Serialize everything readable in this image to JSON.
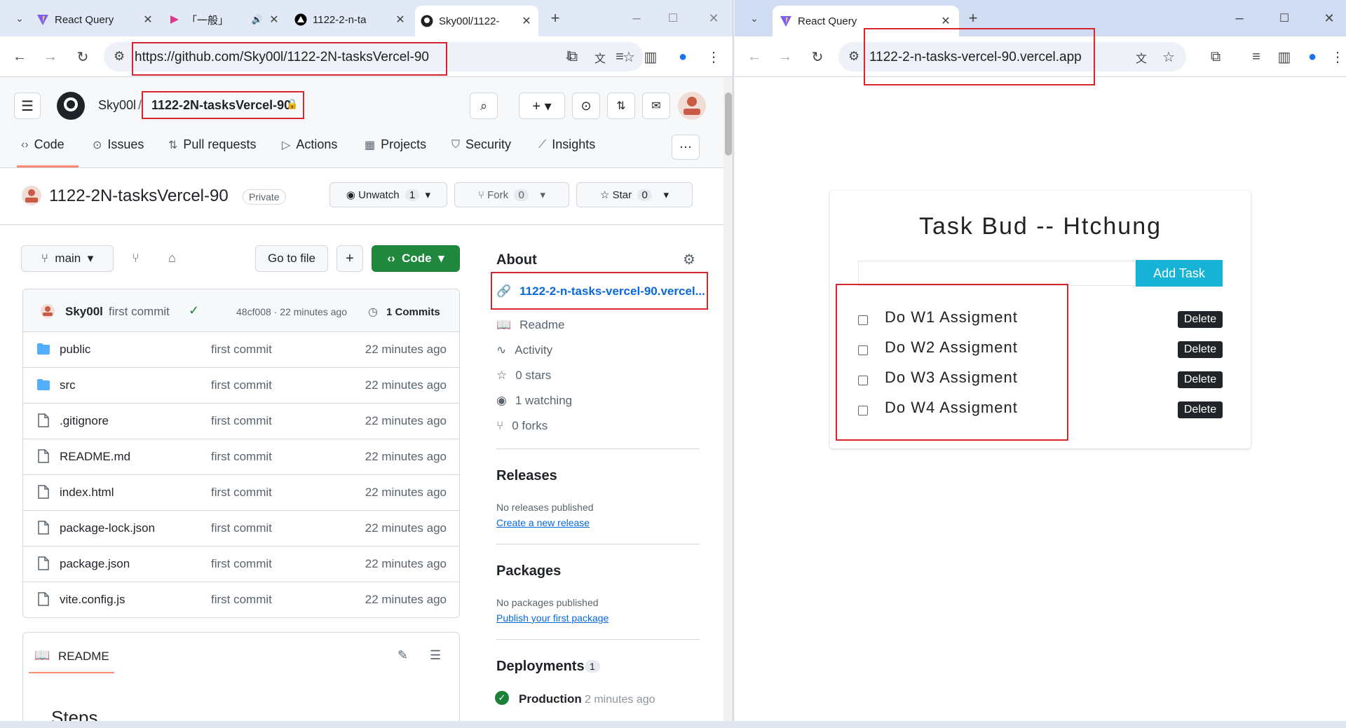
{
  "left_window": {
    "tabs": [
      {
        "title": "React Query"
      },
      {
        "title": "「一般」"
      },
      {
        "title": "1122-2-n-ta"
      },
      {
        "title": "Sky00l/1122-"
      }
    ],
    "url": "https://github.com/Sky00l/1122-2N-tasksVercel-90",
    "github": {
      "owner": "Sky00l",
      "repo": "1122-2N-tasksVercel-90",
      "nav": [
        "Code",
        "Issues",
        "Pull requests",
        "Actions",
        "Projects",
        "Security",
        "Insights"
      ],
      "visibility": "Private",
      "unwatch_label": "Unwatch",
      "unwatch_count": "1",
      "fork_label": "Fork",
      "fork_count": "0",
      "star_label": "Star",
      "star_count": "0",
      "branch": "main",
      "go_to_file": "Go to file",
      "code_btn": "Code",
      "commit": {
        "author": "Sky00l",
        "message": "first commit",
        "hash_time": "48cf008 · 22 minutes ago",
        "count": "1 Commits"
      },
      "files": [
        {
          "name": "public",
          "msg": "first commit",
          "time": "22 minutes ago",
          "type": "dir"
        },
        {
          "name": "src",
          "msg": "first commit",
          "time": "22 minutes ago",
          "type": "dir"
        },
        {
          "name": ".gitignore",
          "msg": "first commit",
          "time": "22 minutes ago",
          "type": "file"
        },
        {
          "name": "README.md",
          "msg": "first commit",
          "time": "22 minutes ago",
          "type": "file"
        },
        {
          "name": "index.html",
          "msg": "first commit",
          "time": "22 minutes ago",
          "type": "file"
        },
        {
          "name": "package-lock.json",
          "msg": "first commit",
          "time": "22 minutes ago",
          "type": "file"
        },
        {
          "name": "package.json",
          "msg": "first commit",
          "time": "22 minutes ago",
          "type": "file"
        },
        {
          "name": "vite.config.js",
          "msg": "first commit",
          "time": "22 minutes ago",
          "type": "file"
        }
      ],
      "readme_title": "README",
      "readme_heading": "Steps",
      "about": {
        "title": "About",
        "link": "1122-2-n-tasks-vercel-90.vercel...",
        "readme": "Readme",
        "activity": "Activity",
        "stars": "0 stars",
        "watching": "1 watching",
        "forks": "0 forks"
      },
      "releases": {
        "title": "Releases",
        "none": "No releases published",
        "create": "Create a new release"
      },
      "packages": {
        "title": "Packages",
        "none": "No packages published",
        "publish": "Publish your first package"
      },
      "deployments": {
        "title": "Deployments",
        "count": "1",
        "env": "Production",
        "time": "2 minutes ago"
      }
    }
  },
  "right_window": {
    "tab_title": "React Query",
    "url": "1122-2-n-tasks-vercel-90.vercel.app",
    "app": {
      "title": "Task Bud -- Htchung",
      "input_value": "",
      "add_button": "Add Task",
      "tasks": [
        {
          "label": "Do W1 Assigment",
          "done": false,
          "delete": "Delete"
        },
        {
          "label": "Do W2 Assigment",
          "done": false,
          "delete": "Delete"
        },
        {
          "label": "Do W3 Assigment",
          "done": false,
          "delete": "Delete"
        },
        {
          "label": "Do W4 Assigment",
          "done": false,
          "delete": "Delete"
        }
      ]
    }
  },
  "colors": {
    "highlight": "#d6252b",
    "gh_green": "#1f883d",
    "app_accent": "#17b3d6"
  }
}
